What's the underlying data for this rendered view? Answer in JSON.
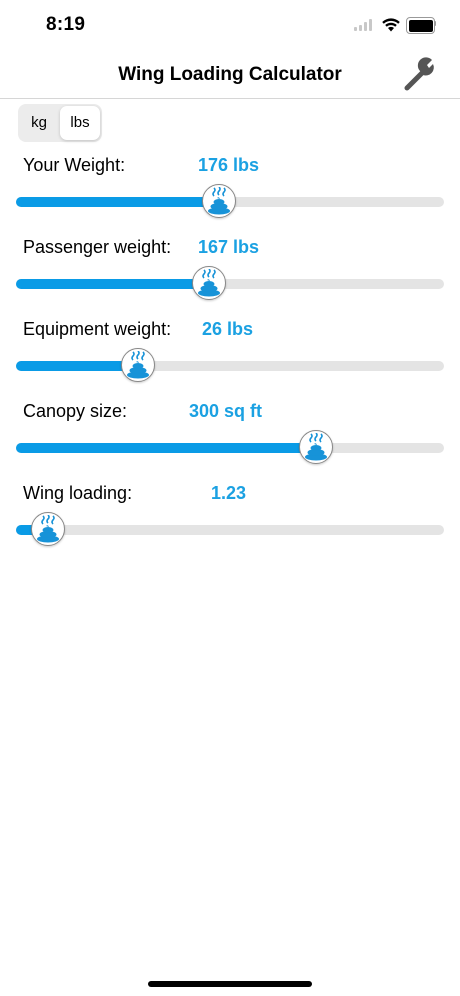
{
  "status_bar": {
    "time": "8:19"
  },
  "nav": {
    "title": "Wing Loading Calculator",
    "settings_icon": "wrench-icon"
  },
  "units": {
    "options": [
      "kg",
      "lbs"
    ],
    "selected": "lbs"
  },
  "rows": [
    {
      "label": "Your Weight:",
      "value": "176 lbs",
      "slider_fraction": 0.475
    },
    {
      "label": "Passenger weight:",
      "value": "167 lbs",
      "slider_fraction": 0.45
    },
    {
      "label": "Equipment weight:",
      "value": "26 lbs",
      "slider_fraction": 0.285
    },
    {
      "label": "Canopy size:",
      "value": "300 sq ft",
      "slider_fraction": 0.7
    },
    {
      "label": "Wing loading:",
      "value": "1.23",
      "slider_fraction": 0.075
    }
  ],
  "colors": {
    "accent": "#1ba1e2",
    "track_fill": "#0a9be6",
    "track": "#e4e4e4"
  },
  "thumb_icon": "steaming-poop-icon"
}
